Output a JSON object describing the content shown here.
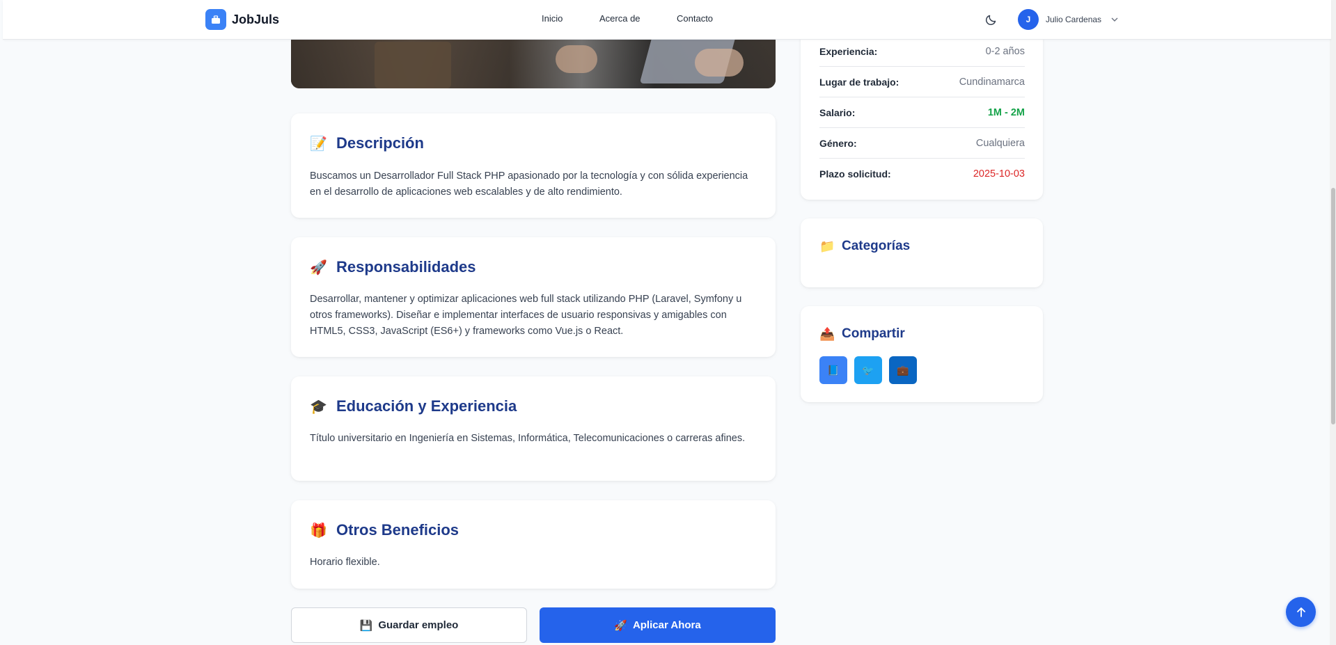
{
  "header": {
    "brand": "JobJuls",
    "nav": [
      "Inicio",
      "Acerca de",
      "Contacto"
    ],
    "user_initial": "J",
    "user_name": "Julio Cardenas"
  },
  "sections": [
    {
      "emoji": "📝",
      "title": "Descripción",
      "body": "Buscamos un Desarrollador Full Stack PHP apasionado por la tecnología y con sólida experiencia en el desarrollo de aplicaciones web escalables y de alto rendimiento."
    },
    {
      "emoji": "🚀",
      "title": "Responsabilidades",
      "body": "Desarrollar, mantener y optimizar aplicaciones web full stack utilizando PHP (Laravel, Symfony u otros frameworks). Diseñar e implementar interfaces de usuario responsivas y amigables con HTML5, CSS3, JavaScript (ES6+) y frameworks como Vue.js o React."
    },
    {
      "emoji": "🎓",
      "title": "Educación y Experiencia",
      "body": "Título universitario en Ingeniería en Sistemas, Informática, Telecomunicaciones o carreras afines."
    },
    {
      "emoji": "🎁",
      "title": "Otros Beneficios",
      "body": "Horario flexible."
    }
  ],
  "details": [
    {
      "label": "Experiencia:",
      "value": "0-2 años",
      "color": "#6b7280"
    },
    {
      "label": "Lugar de trabajo:",
      "value": "Cundinamarca",
      "color": "#6b7280"
    },
    {
      "label": "Salario:",
      "value": "1M - 2M",
      "color": "#16a34a"
    },
    {
      "label": "Género:",
      "value": "Cualquiera",
      "color": "#6b7280"
    },
    {
      "label": "Plazo solicitud:",
      "value": "2025-10-03",
      "color": "#dc2626"
    }
  ],
  "categories": {
    "emoji": "📁",
    "title": "Categorías"
  },
  "share": {
    "emoji": "📤",
    "title": "Compartir",
    "buttons": [
      {
        "icon": "📘",
        "bg": "#3b82f6"
      },
      {
        "icon": "🐦",
        "bg": "#1da1f2"
      },
      {
        "icon": "💼",
        "bg": "#0a66c2"
      }
    ]
  },
  "actions": {
    "save_emoji": "💾",
    "save_label": "Guardar empleo",
    "apply_emoji": "🚀",
    "apply_label": "Aplicar Ahora"
  }
}
